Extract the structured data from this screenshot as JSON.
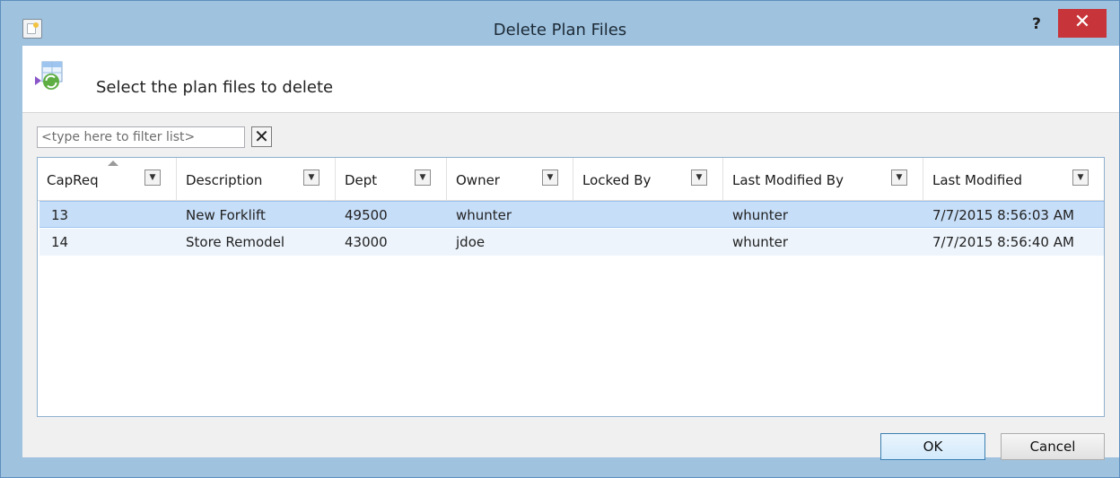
{
  "window": {
    "title": "Delete Plan Files",
    "help_label": "?",
    "close_label": "✕"
  },
  "header": {
    "instruction": "Select the plan files to delete"
  },
  "filter": {
    "placeholder": "<type here to filter list>",
    "clear_label": "✕"
  },
  "grid": {
    "columns": [
      "CapReq",
      "Description",
      "Dept",
      "Owner",
      "Locked By",
      "Last Modified By",
      "Last Modified"
    ],
    "sorted_column": "CapReq",
    "rows": [
      {
        "capreq": "13",
        "description": "New Forklift",
        "dept": "49500",
        "owner": "whunter",
        "locked_by": "",
        "last_modified_by": "whunter",
        "last_modified": "7/7/2015 8:56:03 AM",
        "selected": true
      },
      {
        "capreq": "14",
        "description": "Store Remodel",
        "dept": "43000",
        "owner": "jdoe",
        "locked_by": "",
        "last_modified_by": "whunter",
        "last_modified": "7/7/2015 8:56:40 AM",
        "selected": false
      }
    ]
  },
  "buttons": {
    "ok": "OK",
    "cancel": "Cancel"
  },
  "colors": {
    "titlebar": "#9fc2df",
    "close": "#c7353a",
    "selection": "#c7def8"
  }
}
